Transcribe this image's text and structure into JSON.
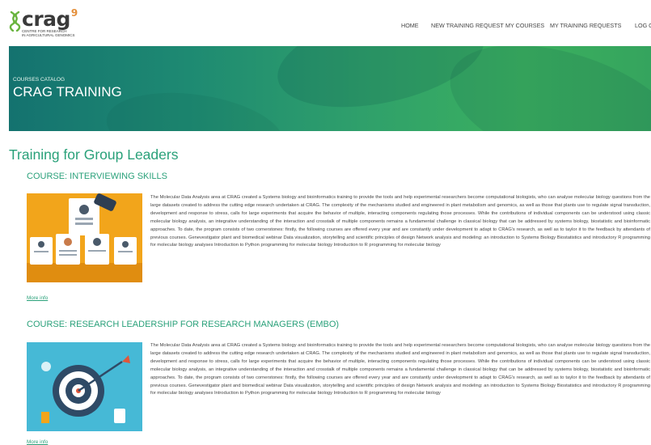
{
  "logo": {
    "name": "crag",
    "suffix": "9",
    "subtitle_line1": "CENTRE FOR RESEARCH",
    "subtitle_line2": "IN AGRICULTURAL GENOMICS"
  },
  "nav": {
    "items": [
      "HOME",
      "NEW TRAINING REQUEST",
      "MY COURSES",
      "MY TRAINING REQUESTS",
      "LOG O"
    ]
  },
  "hero": {
    "kicker": "COURSES CATALOG",
    "title": "CRAG TRAINING"
  },
  "section": {
    "title": "Training for Group Leaders"
  },
  "courses": [
    {
      "title": "COURSE: INTERVIEWING SKILLS",
      "description": "The Molecular Data Analysis area at CRAG created a Systems biology and bioinformatics training to provide the tools and help experimental researchers become computational biologists, who can analyse molecular biology questions from the large datasets created to address the cutting edge research undertaken at CRAG. The complexity of the mechanisms studied and engineered in plant metabolism and genomics, as well as those that plants use to regulate signal transduction, development and response to stress, calls for large experiments that acquire the behavior of multiple, interacting components regulating those processes. While the contributions of individual components can be understood using classic molecular biology analysis, an integrative understanding of the interaction and crosstalk of multiple components remains a fundamental challenge in classical biology that can be addressed by systems biology, biostatistic and bioinformatic approaches. To date, the program consists of two cornerstones: firstly, the following courses are offered every year and are constantly under development to adapt to CRAG's research, as well as to taylor it to the feedback by attendants of previous courses. Genevestigator plant and biomedical webinar Data visualization, storytelling and scientific principles of design Network analysis and modeling: an introduction to Systems Biology Biostatistics and introductory R programming for molecular biology analyses Introduction to Python programming for molecular biology Introduction to R programming for molecular biology",
      "more": "More info"
    },
    {
      "title": "COURSE: RESEARCH LEADERSHIP FOR RESEARCH MANAGERS (EMBO)",
      "description": "The Molecular Data Analysis area at CRAG created a Systems biology and bioinformatics training to provide the tools and help experimental researchers become computational biologists, who can analyse molecular biology questions from the large datasets created to address the cutting edge research undertaken at CRAG. The complexity of the mechanisms studied and engineered in plant metabolism and genomics, as well as those that plants use to regulate signal transduction, development and response to stress, calls for large experiments that acquire the behavior of multiple, interacting components regulating those processes. While the contributions of individual components can be understood using classic molecular biology analysis, an integrative understanding of the interaction and crosstalk of multiple components remains a fundamental challenge in classical biology that can be addressed by systems biology, biostatistic and bioinformatic approaches. To date, the program consists of two cornerstones: firstly, the following courses are offered every year and are constantly under development to adapt to CRAG's research, as well as to taylor it to the feedback by attendants of previous courses. Genevestigator plant and biomedical webinar Data visualization, storytelling and scientific principles of design Network analysis and modeling: an introduction to Systems Biology Biostatistics and introductory R programming for molecular biology analyses Introduction to Python programming for molecular biology Introduction to R programming for molecular biology",
      "more": "More info"
    }
  ],
  "colors": {
    "accent": "#2aa17a",
    "hero_start": "#14726f",
    "hero_end": "#3bb05f",
    "logo_orange": "#e48f3a"
  },
  "icons": [
    "dna-logo-icon",
    "interview-illustration",
    "target-illustration"
  ]
}
